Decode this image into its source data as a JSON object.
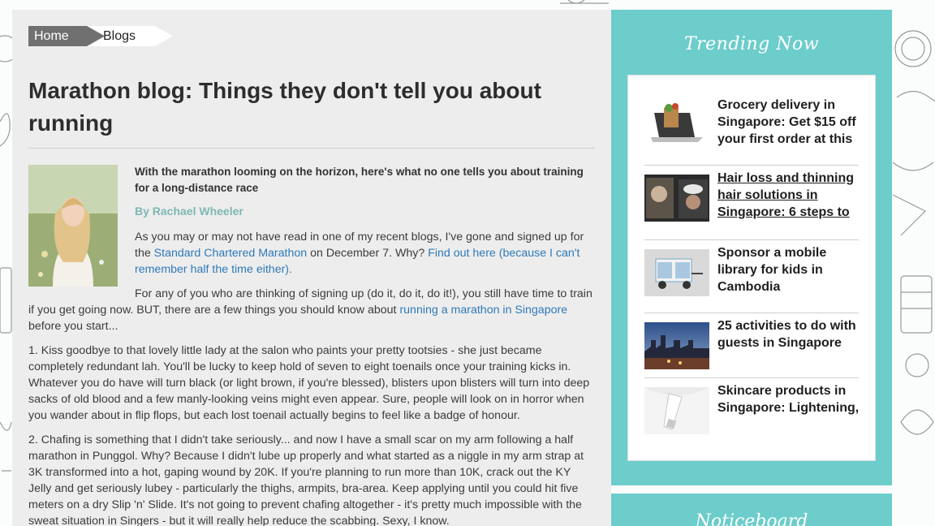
{
  "breadcrumb": {
    "home": "Home",
    "current": "Blogs"
  },
  "article": {
    "title": "Marathon blog: Things they don't tell you about running",
    "lead": "With the marathon looming on the horizon, here's what no one tells you about training for a long-distance race",
    "byline": "By Rachael Wheeler",
    "p1_a": "As you may or may not have read in one of my recent blogs, I've gone and signed up for the ",
    "p1_link1": "Standard Chartered Marathon",
    "p1_b": " on December 7. Why? ",
    "p1_link2": "Find out here (because I can't remember half the time either).",
    "p2_a": "For any of you who are thinking of signing up (do it, do it, do it!), you still have time to train if you get going now. BUT, there are a few things you should know about ",
    "p2_link": "running a marathon in Singapore",
    "p2_b": " before you start...",
    "p3": "1. Kiss goodbye to that lovely little lady at the salon who paints your pretty tootsies - she just became completely redundant lah. You'll be lucky to keep hold of seven to eight toenails once your training kicks in. Whatever you do have will turn black (or light brown, if you're blessed), blisters upon blisters will turn into deep sacks of old blood and a few manly-looking veins might even appear. Sure, people will look on in horror when you wander about in flip flops, but each lost toenail actually begins to feel like a badge of honour.",
    "p4": "2. Chafing is something that I didn't take seriously... and now I have a small scar on my arm following a half marathon in Punggol. Why? Because I didn't lube up properly and what started as a niggle in my arm strap at 3K transformed into a hot, gaping wound by 20K. If you're planning to run more than 10K, crack out the KY Jelly and get seriously lubey - particularly the thighs, armpits, bra-area. Keep applying until you could hit five meters on a dry Slip 'n' Slide. It's not going to prevent chafing altogether - it's pretty much impossible with the sweat situation in Singers - but it will really help reduce the scabbing. Sexy, I know."
  },
  "sidebar": {
    "trending_title": "Trending Now",
    "items": [
      {
        "title": "Grocery delivery in Singapore: Get $15 off your first order at this",
        "thumb": "laptop-groceries"
      },
      {
        "title": "Hair loss and thinning hair solutions in Singapore: 6 steps to",
        "thumb": "hair-salon"
      },
      {
        "title": "Sponsor a mobile library for kids in Cambodia",
        "thumb": "library-cart"
      },
      {
        "title": "25 activities to do with guests in Singapore",
        "thumb": "city-skyline"
      },
      {
        "title": "Skincare products in Singapore: Lightening,",
        "thumb": "skincare-tube"
      }
    ],
    "noticeboard_title": "Noticeboard"
  },
  "colors": {
    "sidebar_bg": "#6ccdcb",
    "link": "#2f7ab9",
    "byline": "#7fb8b3"
  }
}
